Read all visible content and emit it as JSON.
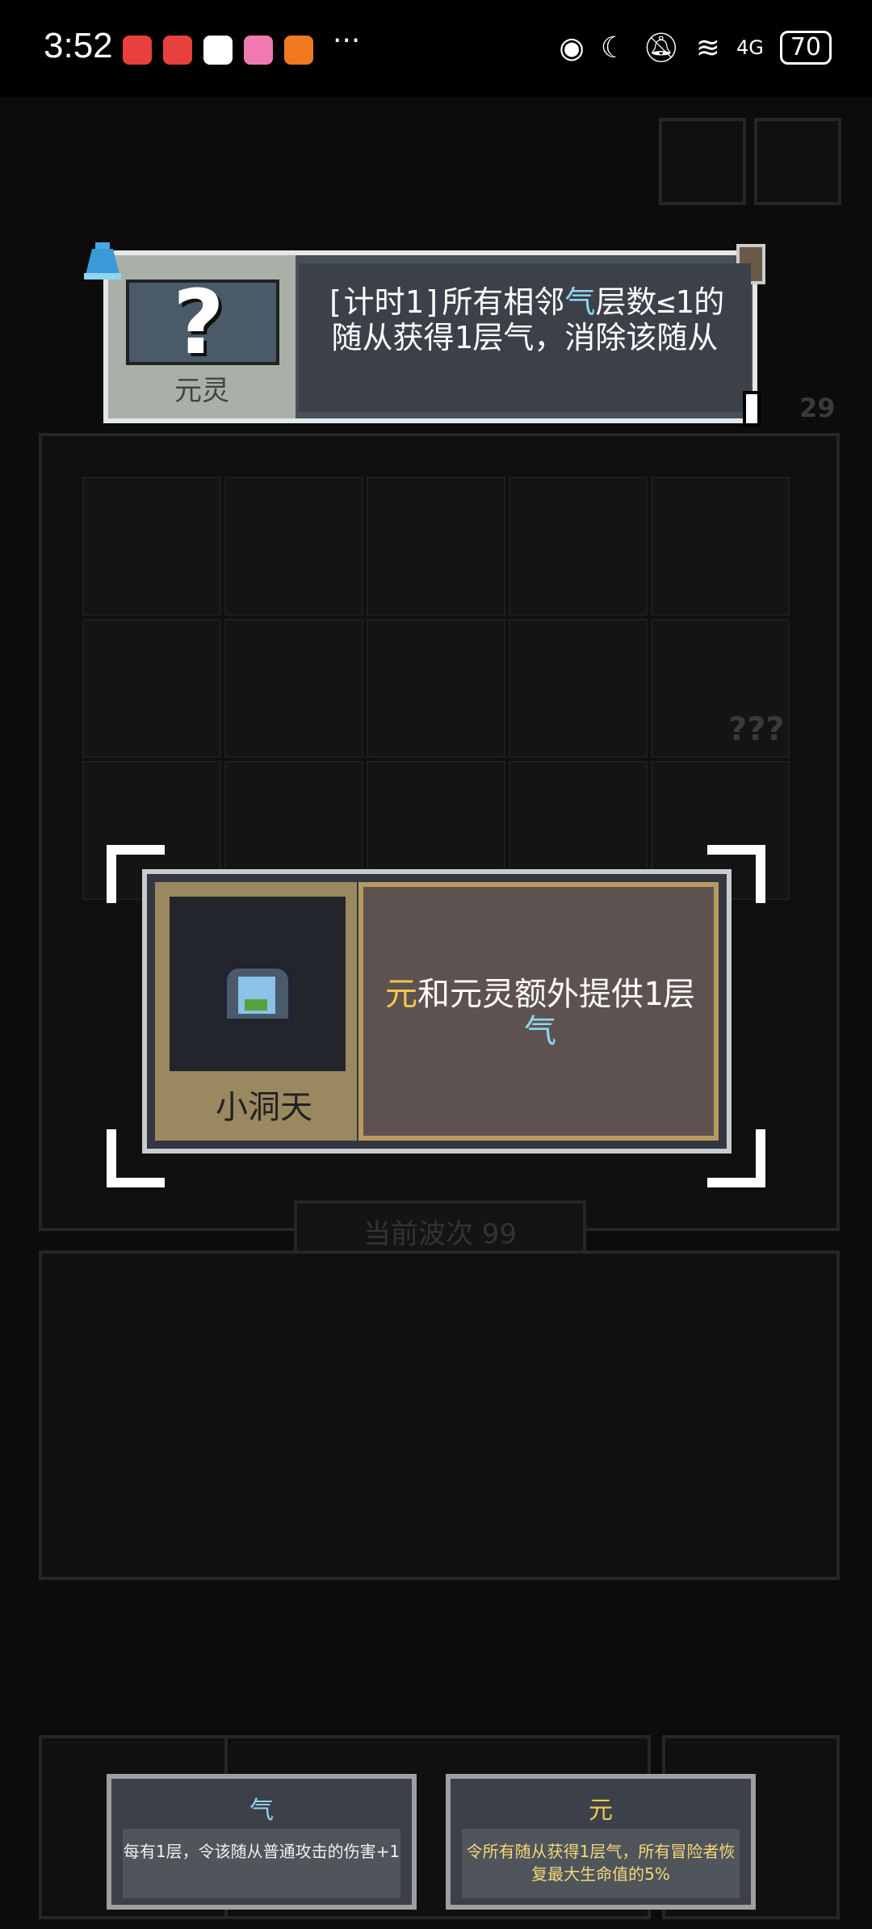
{
  "status_bar": {
    "time": "3:52",
    "more": "···",
    "network": "4G",
    "battery": "70"
  },
  "tooltip": {
    "name": "元灵",
    "desc_part1": "[计时1]所有相邻",
    "desc_highlight": "气",
    "desc_part2": "层数≤1的随从获得1层气，消除该随从"
  },
  "item_card": {
    "name": "小洞天",
    "desc_yellow": "元",
    "desc_mid": "和元灵额外提供1层",
    "desc_blue": "气"
  },
  "background": {
    "wave_label": "当前波次 99",
    "unknown_value": "???",
    "counter": "29"
  },
  "keywords": [
    {
      "title": "气",
      "desc": "每有1层，令该随从普通攻击的伤害+1",
      "color": "#8fd6f0"
    },
    {
      "title": "元",
      "desc": "令所有随从获得1层气，所有冒险者恢复最大生命值的5%",
      "color": "#f0c850"
    }
  ]
}
